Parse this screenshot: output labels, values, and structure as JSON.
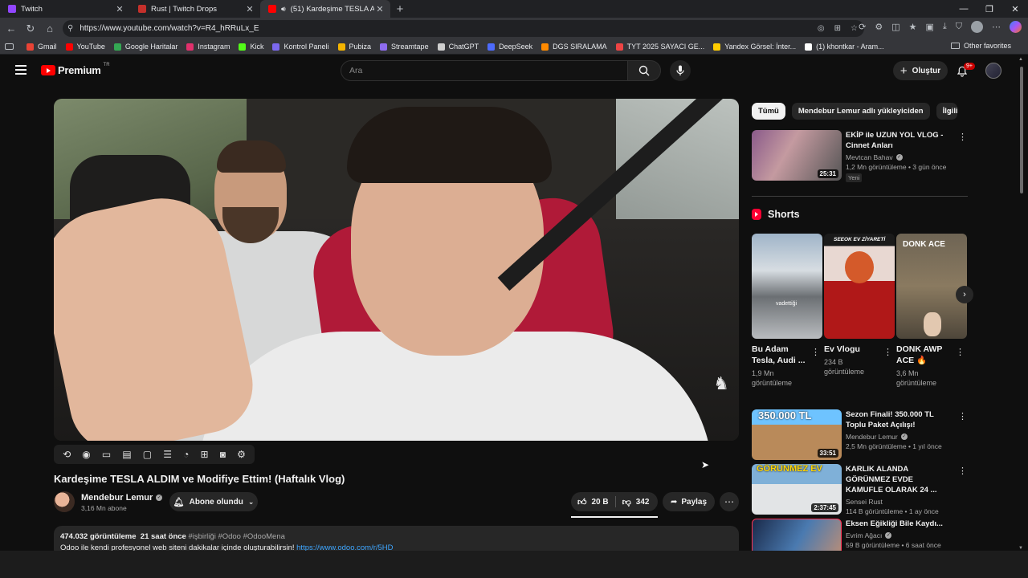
{
  "browser": {
    "tabs": [
      {
        "title": "Twitch",
        "color": "#9146ff"
      },
      {
        "title": "Rust | Twitch Drops",
        "color": "#c4302b"
      },
      {
        "title": "(51) Kardeşime TESLA ALDIM",
        "color": "#ff0000",
        "active": true
      }
    ],
    "new_tab": "+",
    "url": "https://www.youtube.com/watch?v=R4_hRRuLx_E",
    "bookmarks": [
      {
        "label": "Gmail",
        "color": "#ea4335"
      },
      {
        "label": "YouTube",
        "color": "#ff0000"
      },
      {
        "label": "Google Haritalar",
        "color": "#34a853"
      },
      {
        "label": "Instagram",
        "color": "#e1306c"
      },
      {
        "label": "Kick",
        "color": "#53fc18"
      },
      {
        "label": "Kontrol Paneli",
        "color": "#7b68ee"
      },
      {
        "label": "Pubiza",
        "color": "#f4b400"
      },
      {
        "label": "Streamtape",
        "color": "#8e6cf0"
      },
      {
        "label": "ChatGPT",
        "color": "#cfcfcf"
      },
      {
        "label": "DeepSeek",
        "color": "#4d6bfe"
      },
      {
        "label": "DGS SIRALAMA",
        "color": "#ff8a00"
      },
      {
        "label": "TYT 2025 SAYACI GE...",
        "color": "#e44"
      },
      {
        "label": "Yandex Görsel: İnter...",
        "color": "#ffcc00"
      },
      {
        "label": "(1) khontkar - Aram...",
        "color": "#ffffff"
      }
    ],
    "other_favorites": "Other favorites"
  },
  "youtube": {
    "logo_text": "Premium",
    "country": "TR",
    "search_placeholder": "Ara",
    "create_label": "Oluştur",
    "notif_count": "9+"
  },
  "video": {
    "title": "Kardeşime TESLA ALDIM ve Modifiye Ettim! (Haftalık Vlog)",
    "channel": "Mendebur Lemur",
    "subscribers": "3,16 Mn abone",
    "subscribe_label": "Abone olundu",
    "likes": "20 B",
    "dislikes": "342",
    "share_label": "Paylaş",
    "views": "474.032 görüntüleme",
    "age": "21 saat önce",
    "hashtags": "#işbirliği #Odoo #OdooMena",
    "desc_text": "Odoo ile kendi profesyonel web siteni dakikalar içinde oluşturabilirsin!",
    "desc_link": "https://www.odoo.com/r/5HD"
  },
  "chips": [
    "Tümü",
    "Mendebur Lemur adlı yükleyiciden",
    "İlgili"
  ],
  "recommendations": [
    {
      "title": "EKİP ile UZUN YOL VLOG - Cinnet Anları",
      "channel": "Mevtcan Bahav",
      "meta": "1,2 Mn görüntüleme • 3 gün önce",
      "badge": "Yeni",
      "duration": "25:31"
    },
    {
      "title": "Sezon Finali! 350.000 TL Toplu Paket Açılışı!",
      "channel": "Mendebur Lemur",
      "meta": "2,5 Mn görüntüleme • 1 yıl önce",
      "duration": "33:51",
      "thumb_text": "350.000 TL"
    },
    {
      "title": "KARLIK ALANDA GÖRÜNMEZ EVDE KAMUFLE OLARAK 24 ...",
      "channel": "Sensei Rust",
      "meta": "114 B görüntüleme • 1 ay önce",
      "duration": "2:37:45",
      "thumb_text": "GÖRÜNMEZ EV"
    },
    {
      "title": "Eksen Eğikliği Bile Kaydı...",
      "channel": "Evrim Ağacı",
      "meta": "59 B görüntüleme • 6 saat önce",
      "duration": ""
    }
  ],
  "shorts": {
    "heading": "Shorts",
    "items": [
      {
        "title": "Bu Adam Tesla, Audi ...",
        "views": "1,9 Mn görüntüleme",
        "thumb_text": "vadettiği"
      },
      {
        "title": "Ev Vlogu",
        "views": "234 B görüntüleme",
        "thumb_text": "SEEOK EV ZİYARETİ"
      },
      {
        "title": "DONK AWP ACE 🔥",
        "views": "3,6 Mn görüntüleme",
        "thumb_text": "DONK ACE"
      }
    ]
  }
}
